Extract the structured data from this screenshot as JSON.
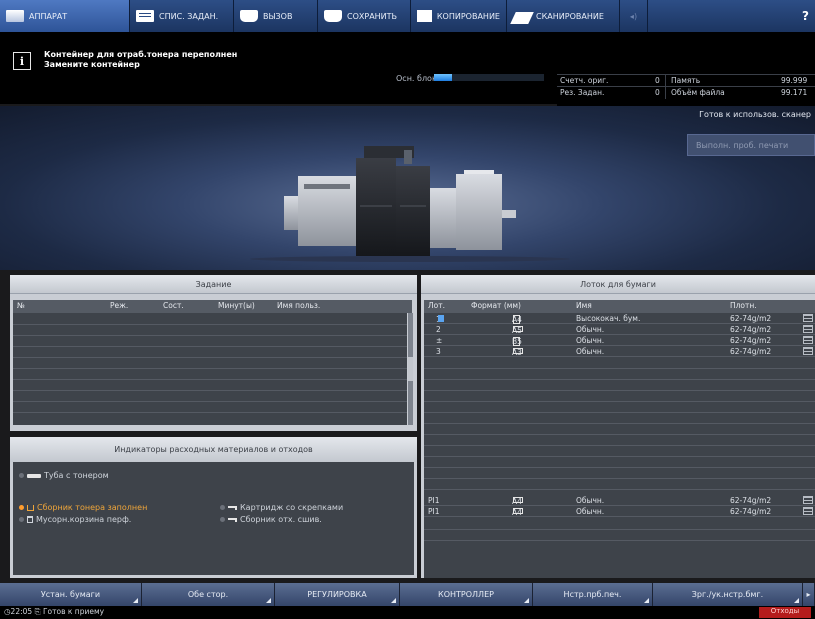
{
  "tabs": [
    {
      "label": "АППАРАТ",
      "icon": "machine-icon",
      "active": true
    },
    {
      "label": "СПИС. ЗАДАН.",
      "icon": "job-list-icon"
    },
    {
      "label": "ВЫЗОВ",
      "icon": "recall-icon"
    },
    {
      "label": "СОХРАНИТЬ",
      "icon": "save-icon"
    },
    {
      "label": "КОПИРОВАНИЕ",
      "icon": "copy-icon"
    },
    {
      "label": "СКАНИРОВАНИЕ",
      "icon": "scan-icon"
    },
    {
      "label": "",
      "icon": "settings-icon"
    },
    {
      "label": "?",
      "icon": "help-icon"
    }
  ],
  "message": {
    "line1": "Контейнер для отраб.тонера переполнен",
    "line2": "Замените контейнер",
    "main_unit_label": "Осн. блок",
    "main_unit_progress": 0.16
  },
  "counters": {
    "orig_label": "Счетч. ориг.",
    "orig_value": "0",
    "memory_label": "Память",
    "memory_value": "99.999",
    "reserved_label": "Рез. Задан.",
    "reserved_value": "0",
    "filesize_label": "Объём файла",
    "filesize_value": "99.171"
  },
  "banner": {
    "ready_text": "Готов к использов. сканер",
    "sample_button": "Выполн. проб. печати"
  },
  "job_panel": {
    "title": "Задание",
    "columns": [
      "№",
      "Реж.",
      "Сост.",
      "Минут(ы)",
      "Имя польз."
    ]
  },
  "consumables": {
    "title": "Индикаторы расходных материалов и отходов",
    "toner_tube": "Туба с тонером",
    "toner_box_full": "Сборник тонера заполнен",
    "punch_bin": "Мусорн.корзина перф.",
    "staple_cartridge": "Картридж со скрепками",
    "staple_waste": "Сборник отх. сшив."
  },
  "tray_panel": {
    "title": "Лоток для бумаги",
    "columns": [
      "Лот.",
      "Формат (мм)",
      "Имя",
      "Плотн."
    ],
    "rows": [
      {
        "tray": "1",
        "size": "A4",
        "name": "Высококач. бум.",
        "weight": "62-74g/m2"
      },
      {
        "tray": "2",
        "size": "A5",
        "name": "Обычн.",
        "weight": "62-74g/m2"
      },
      {
        "tray": "±",
        "size": "B5",
        "name": "Обычн.",
        "weight": "62-74g/m2"
      },
      {
        "tray": "3",
        "size": "A3",
        "name": "Обычн.",
        "weight": "62-74g/m2"
      }
    ],
    "pi_rows": [
      {
        "tray": "PI1",
        "size": "A4",
        "name": "Обычн.",
        "weight": "62-74g/m2"
      },
      {
        "tray": "PI1",
        "size": "A4",
        "name": "Обычн.",
        "weight": "62-74g/m2"
      }
    ]
  },
  "bottom_buttons": [
    "Устан. бумаги",
    "Обе стор.",
    "РЕГУЛИРОВКА",
    "КОНТРОЛЛЕР",
    "Нстр.прб.печ.",
    "Зрг./ук.нстр.бмг.",
    "▸"
  ],
  "status_bar": {
    "time": "22:05",
    "text": "Готов к приему",
    "alert": "Отходы"
  },
  "colors": {
    "tab_bg": "#1c3561",
    "tab_active": "#4f79c2",
    "warning_orange": "#f0a63a",
    "alert_red": "#b41c1c"
  }
}
